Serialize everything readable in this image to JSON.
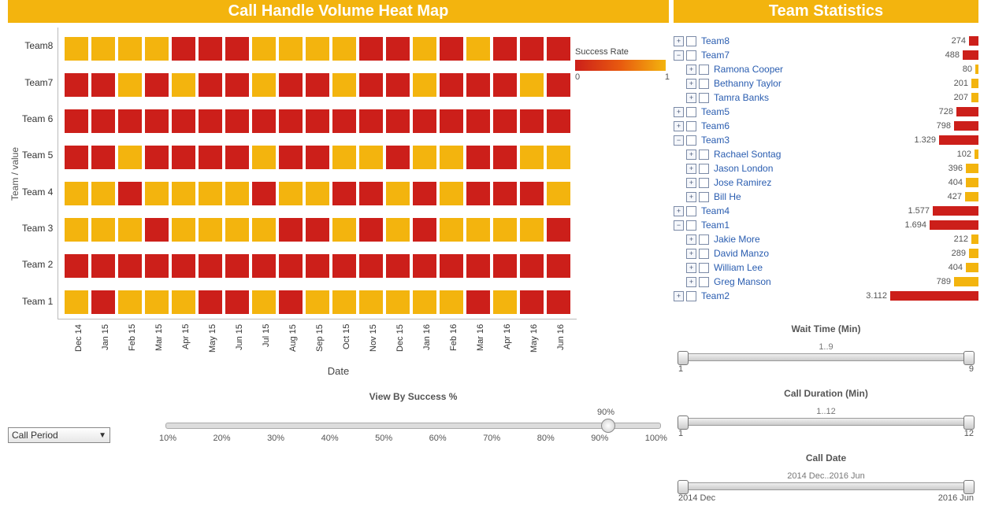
{
  "left": {
    "title": "Call Handle Volume Heat Map",
    "ylabel": "Team / value",
    "xlabel": "Date",
    "legend_title": "Success Rate",
    "legend_min": "0",
    "legend_max": "1",
    "view_slider_title": "View By Success %",
    "view_slider_value": "90%",
    "view_slider_ticks": [
      "10%",
      "20%",
      "30%",
      "40%",
      "50%",
      "60%",
      "70%",
      "80%",
      "90%",
      "100%"
    ],
    "dropdown_label": "Call Period"
  },
  "right": {
    "title": "Team Statistics",
    "sliders": [
      {
        "title": "Wait Time (Min)",
        "range": "1..9",
        "min": "1",
        "max": "9"
      },
      {
        "title": "Call Duration (Min)",
        "range": "1..12",
        "min": "1",
        "max": "12"
      },
      {
        "title": "Call Date",
        "range": "2014 Dec..2016 Jun",
        "min": "2014 Dec",
        "max": "2016 Jun"
      }
    ]
  },
  "chart_data": {
    "type": "heatmap",
    "title": "Call Handle Volume Heat Map",
    "ylabel": "Team / value",
    "xlabel": "Date",
    "y_categories": [
      "Team8",
      "Team7",
      "Team 6",
      "Team 5",
      "Team 4",
      "Team 3",
      "Team 2",
      "Team 1"
    ],
    "x_categories": [
      "Dec 14",
      "Jan 15",
      "Feb 15",
      "Mar 15",
      "Apr 15",
      "May 15",
      "Jun 15",
      "Jul 15",
      "Aug 15",
      "Sep 15",
      "Oct 15",
      "Nov 15",
      "Dec 15",
      "Jan 16",
      "Feb 16",
      "Mar 16",
      "Apr 16",
      "May 16",
      "Jun 16"
    ],
    "values": [
      [
        1,
        1,
        1,
        1,
        0,
        0,
        0,
        1,
        1,
        1,
        1,
        0,
        0,
        1,
        0,
        1,
        0,
        0,
        0
      ],
      [
        0,
        0,
        1,
        0,
        1,
        0,
        0,
        1,
        0,
        0,
        1,
        0,
        0,
        1,
        0,
        0,
        0,
        1,
        0
      ],
      [
        0,
        0,
        0,
        0,
        0,
        0,
        0,
        0,
        0,
        0,
        0,
        0,
        0,
        0,
        0,
        0,
        0,
        0,
        0
      ],
      [
        0,
        0,
        1,
        0,
        0,
        0,
        0,
        1,
        0,
        0,
        1,
        1,
        0,
        1,
        1,
        0,
        0,
        1,
        1
      ],
      [
        1,
        1,
        0,
        1,
        1,
        1,
        1,
        0,
        1,
        1,
        0,
        0,
        1,
        0,
        1,
        0,
        0,
        0,
        1
      ],
      [
        1,
        1,
        1,
        0,
        1,
        1,
        1,
        1,
        0,
        0,
        1,
        0,
        1,
        0,
        1,
        1,
        1,
        1,
        0
      ],
      [
        0,
        0,
        0,
        0,
        0,
        0,
        0,
        0,
        0,
        0,
        0,
        0,
        0,
        0,
        0,
        0,
        0,
        0,
        0
      ],
      [
        1,
        0,
        1,
        1,
        1,
        0,
        0,
        1,
        0,
        1,
        1,
        1,
        1,
        1,
        1,
        0,
        1,
        0,
        0
      ]
    ],
    "color_legend": {
      "label": "Success Rate",
      "min": 0,
      "max": 1,
      "low_color": "#cc1f1a",
      "high_color": "#f3b40e"
    }
  },
  "tree": [
    {
      "level": 0,
      "expand": "+",
      "label": "Team8",
      "value": "274",
      "bar": 12,
      "color": "red"
    },
    {
      "level": 0,
      "expand": "-",
      "label": "Team7",
      "value": "488",
      "bar": 20,
      "color": "red"
    },
    {
      "level": 1,
      "expand": "+",
      "label": "Ramona Cooper",
      "value": "80",
      "bar": 4,
      "color": "yel"
    },
    {
      "level": 1,
      "expand": "+",
      "label": "Bethanny Taylor",
      "value": "201",
      "bar": 9,
      "color": "yel"
    },
    {
      "level": 1,
      "expand": "+",
      "label": "Tamra Banks",
      "value": "207",
      "bar": 9,
      "color": "yel"
    },
    {
      "level": 0,
      "expand": "+",
      "label": "Team5",
      "value": "728",
      "bar": 28,
      "color": "red"
    },
    {
      "level": 0,
      "expand": "+",
      "label": "Team6",
      "value": "798",
      "bar": 31,
      "color": "red"
    },
    {
      "level": 0,
      "expand": "-",
      "label": "Team3",
      "value": "1.329",
      "bar": 50,
      "color": "red"
    },
    {
      "level": 1,
      "expand": "+",
      "label": "Rachael Sontag",
      "value": "102",
      "bar": 5,
      "color": "yel"
    },
    {
      "level": 1,
      "expand": "+",
      "label": "Jason London",
      "value": "396",
      "bar": 16,
      "color": "yel"
    },
    {
      "level": 1,
      "expand": "+",
      "label": "Jose Ramirez",
      "value": "404",
      "bar": 16,
      "color": "yel"
    },
    {
      "level": 1,
      "expand": "+",
      "label": "Bill He",
      "value": "427",
      "bar": 17,
      "color": "yel"
    },
    {
      "level": 0,
      "expand": "+",
      "label": "Team4",
      "value": "1.577",
      "bar": 58,
      "color": "red"
    },
    {
      "level": 0,
      "expand": "-",
      "label": "Team1",
      "value": "1.694",
      "bar": 62,
      "color": "red"
    },
    {
      "level": 1,
      "expand": "+",
      "label": "Jakie More",
      "value": "212",
      "bar": 9,
      "color": "yel"
    },
    {
      "level": 1,
      "expand": "+",
      "label": "David Manzo",
      "value": "289",
      "bar": 12,
      "color": "yel"
    },
    {
      "level": 1,
      "expand": "+",
      "label": "William Lee",
      "value": "404",
      "bar": 16,
      "color": "yel"
    },
    {
      "level": 1,
      "expand": "+",
      "label": "Greg Manson",
      "value": "789",
      "bar": 31,
      "color": "yel"
    },
    {
      "level": 0,
      "expand": "+",
      "label": "Team2",
      "value": "3.112",
      "bar": 112,
      "color": "red"
    }
  ]
}
